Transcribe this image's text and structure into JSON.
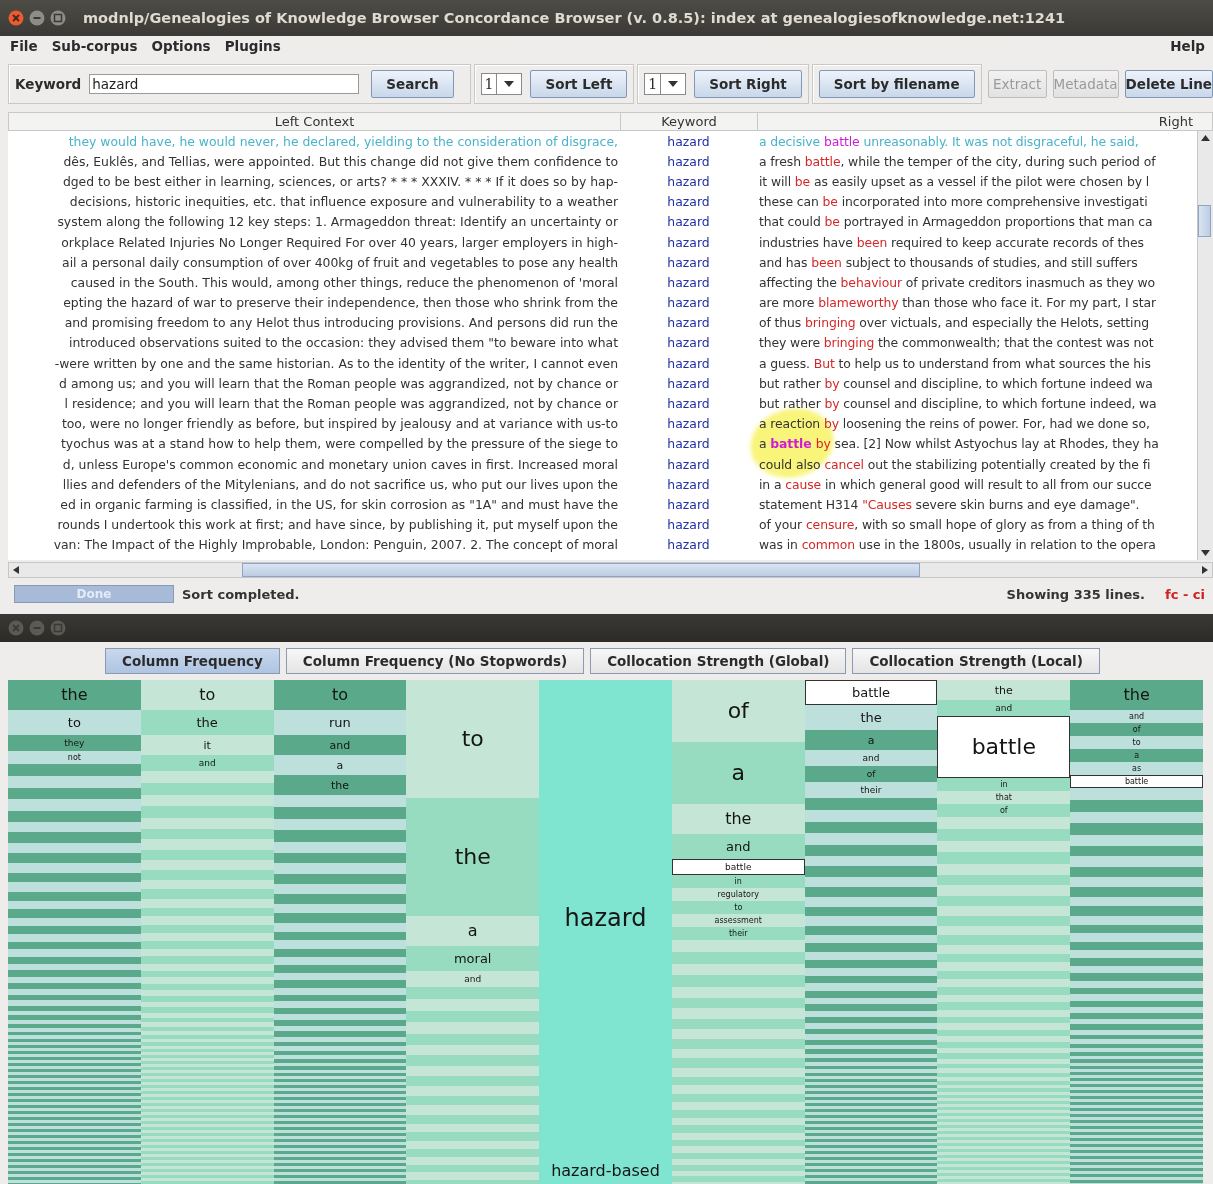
{
  "window": {
    "title": "modnlp/Genealogies of Knowledge Browser Concordance Browser (v. 0.8.5): index at genealogiesofknowledge.net:1241"
  },
  "menus": [
    "File",
    "Sub-corpus",
    "Options",
    "Plugins"
  ],
  "help_menu": "Help",
  "toolbar": {
    "keyword_label": "Keyword",
    "keyword": "hazard",
    "search_button": "Search",
    "sort_left": {
      "depth": "1",
      "button": "Sort Left"
    },
    "sort_right": {
      "depth": "1",
      "button": "Sort Right"
    },
    "buttons": [
      {
        "label": "Sort by filename",
        "disabled": false,
        "grouped": true
      },
      {
        "label": "Extract",
        "disabled": true,
        "grouped": false
      },
      {
        "label": "Metadata",
        "disabled": true,
        "grouped": false
      },
      {
        "label": "Delete Line",
        "disabled": false,
        "grouped": false
      }
    ]
  },
  "concordance": {
    "columns": [
      "Left Context",
      "Keyword",
      "Right"
    ],
    "marker_highlight": true,
    "rows": [
      {
        "selected": true,
        "left": "they would have, he would never, he declared, yielding to the consideration of disgrace,",
        "keyword": "hazard",
        "right": [
          {
            "text": "a decisive ",
            "kind": "plain"
          },
          {
            "text": "battle",
            "kind": "hit"
          },
          {
            "text": " unreasonably. It was not disgraceful, he said,",
            "kind": "plain"
          }
        ]
      },
      {
        "selected": false,
        "left": "dês, Euklês, and Tellias, were appointed. But this change did not give them confidence to",
        "keyword": "hazard",
        "right": [
          {
            "text": "a fresh ",
            "kind": "plain"
          },
          {
            "text": "battle",
            "kind": "sort"
          },
          {
            "text": ", while the temper of the city, during such period of",
            "kind": "plain"
          }
        ]
      },
      {
        "selected": false,
        "left": "dged to be best either in learning, sciences, or arts? * * * XXXIV. * * * If it does so by hap-",
        "keyword": "hazard",
        "right": [
          {
            "text": "it will ",
            "kind": "plain"
          },
          {
            "text": "be",
            "kind": "sort"
          },
          {
            "text": " as easily upset as a vessel if the pilot were chosen by l",
            "kind": "plain"
          }
        ]
      },
      {
        "selected": false,
        "left": "decisions, historic inequities, etc. that influence exposure and vulnerability to a weather",
        "keyword": "hazard",
        "right": [
          {
            "text": "these can ",
            "kind": "plain"
          },
          {
            "text": "be",
            "kind": "sort"
          },
          {
            "text": " incorporated into more comprehensive investigati",
            "kind": "plain"
          }
        ]
      },
      {
        "selected": false,
        "left": "system along the following 12 key steps: 1. Armageddon threat: Identify an uncertainty or",
        "keyword": "hazard",
        "right": [
          {
            "text": "that could ",
            "kind": "plain"
          },
          {
            "text": "be",
            "kind": "sort"
          },
          {
            "text": " portrayed in Armageddon proportions that man ca",
            "kind": "plain"
          }
        ]
      },
      {
        "selected": false,
        "left": "orkplace Related Injuries No Longer Required For over 40 years, larger employers in high-",
        "keyword": "hazard",
        "right": [
          {
            "text": "industries have ",
            "kind": "plain"
          },
          {
            "text": "been",
            "kind": "sort"
          },
          {
            "text": " required to keep accurate records of thes",
            "kind": "plain"
          }
        ]
      },
      {
        "selected": false,
        "left": "ail a personal daily consumption of over 400kg of fruit and vegetables to pose any health",
        "keyword": "hazard",
        "right": [
          {
            "text": "and has ",
            "kind": "plain"
          },
          {
            "text": "been",
            "kind": "sort"
          },
          {
            "text": " subject to thousands of studies, and still suffers",
            "kind": "plain"
          }
        ]
      },
      {
        "selected": false,
        "left": "caused in the South. This would, among other things, reduce the phenomenon of 'moral",
        "keyword": "hazard",
        "right": [
          {
            "text": "affecting the ",
            "kind": "plain"
          },
          {
            "text": "behaviour",
            "kind": "sort"
          },
          {
            "text": " of private creditors inasmuch as they wo",
            "kind": "plain"
          }
        ]
      },
      {
        "selected": false,
        "left": "epting the hazard of war to preserve their independence, then those who shrink from the",
        "keyword": "hazard",
        "right": [
          {
            "text": "are more ",
            "kind": "plain"
          },
          {
            "text": "blameworthy",
            "kind": "sort"
          },
          {
            "text": " than those who face it. For my part, I star",
            "kind": "plain"
          }
        ]
      },
      {
        "selected": false,
        "left": "and promising freedom to any Helot thus introducing provisions. And persons did run the",
        "keyword": "hazard",
        "right": [
          {
            "text": "of thus ",
            "kind": "plain"
          },
          {
            "text": "bringing",
            "kind": "sort"
          },
          {
            "text": " over victuals, and especially the Helots, setting",
            "kind": "plain"
          }
        ]
      },
      {
        "selected": false,
        "left": "introduced observations suited to the occasion: they advised them \"to beware into what",
        "keyword": "hazard",
        "right": [
          {
            "text": "they were ",
            "kind": "plain"
          },
          {
            "text": "bringing",
            "kind": "sort"
          },
          {
            "text": " the commonwealth; that the contest was not",
            "kind": "plain"
          }
        ]
      },
      {
        "selected": false,
        "left": "-were written by one and the same historian. As to the identity of the writer, I cannot even",
        "keyword": "hazard",
        "right": [
          {
            "text": "a guess. ",
            "kind": "plain"
          },
          {
            "text": "But",
            "kind": "sort"
          },
          {
            "text": " to help us to understand from what sources the his",
            "kind": "plain"
          }
        ]
      },
      {
        "selected": false,
        "left": "d among us; and you will learn that the Roman people was aggrandized, not by chance or",
        "keyword": "hazard",
        "right": [
          {
            "text": "but rather ",
            "kind": "plain"
          },
          {
            "text": "by",
            "kind": "sort"
          },
          {
            "text": " counsel and discipline, to which fortune indeed wa",
            "kind": "plain"
          }
        ]
      },
      {
        "selected": false,
        "left": "l residence; and you will learn that the Roman people was aggrandized, not by chance or",
        "keyword": "hazard",
        "right": [
          {
            "text": "but rather ",
            "kind": "plain"
          },
          {
            "text": "by",
            "kind": "sort"
          },
          {
            "text": " counsel and discipline, to which fortune indeed, wa",
            "kind": "plain"
          }
        ]
      },
      {
        "selected": false,
        "left": "too, were no longer friendly as before, but inspired by jealousy and at variance with us-to",
        "keyword": "hazard",
        "right": [
          {
            "text": "a reaction ",
            "kind": "plain"
          },
          {
            "text": "by",
            "kind": "sort"
          },
          {
            "text": " loosening the reins of power. For, had we done so,",
            "kind": "plain"
          }
        ]
      },
      {
        "selected": false,
        "left": "tyochus was at a stand how to help them, were compelled by the pressure of the siege to",
        "keyword": "hazard",
        "right": [
          {
            "text": "a ",
            "kind": "plain"
          },
          {
            "text": "battle ",
            "kind": "hit"
          },
          {
            "text": "by",
            "kind": "sort"
          },
          {
            "text": " sea. [2] Now whilst Astyochus lay at Rhodes, they ha",
            "kind": "plain"
          }
        ]
      },
      {
        "selected": false,
        "left": "d, unless Europe's common economic and monetary union caves in first. Increased moral",
        "keyword": "hazard",
        "right": [
          {
            "text": "could also ",
            "kind": "plain"
          },
          {
            "text": "cancel",
            "kind": "sort"
          },
          {
            "text": " out the stabilizing potentially created by the fi",
            "kind": "plain"
          }
        ]
      },
      {
        "selected": false,
        "left": "llies and defenders of the Mitylenians, and do not sacrifice us, who put our lives upon the",
        "keyword": "hazard",
        "right": [
          {
            "text": "in a ",
            "kind": "plain"
          },
          {
            "text": "cause",
            "kind": "sort"
          },
          {
            "text": " in which general good will result to all from our succe",
            "kind": "plain"
          }
        ]
      },
      {
        "selected": false,
        "left": "ed in organic farming is classified, in the US, for skin corrosion as \"1A\" and must have the",
        "keyword": "hazard",
        "right": [
          {
            "text": "statement H314 ",
            "kind": "plain"
          },
          {
            "text": "\"Causes",
            "kind": "sort"
          },
          {
            "text": " severe skin burns and eye damage\".",
            "kind": "plain"
          }
        ]
      },
      {
        "selected": false,
        "left": "rounds I undertook this work at first; and have since, by publishing it, put myself upon the",
        "keyword": "hazard",
        "right": [
          {
            "text": "of your ",
            "kind": "plain"
          },
          {
            "text": "censure",
            "kind": "sort"
          },
          {
            "text": ", with so small hope of glory as from a thing of th",
            "kind": "plain"
          }
        ]
      },
      {
        "selected": false,
        "left": "van: The Impact of the Highly Improbable, London: Penguin, 2007. 2. The concept of moral",
        "keyword": "hazard",
        "right": [
          {
            "text": "was in ",
            "kind": "plain"
          },
          {
            "text": "common",
            "kind": "sort"
          },
          {
            "text": " use in the 1800s, usually in relation to the opera",
            "kind": "plain"
          }
        ]
      }
    ]
  },
  "status_bar": {
    "progress": {
      "label": "Done",
      "level": 1
    },
    "message": "Sort completed.",
    "lines": "Showing 335 lines.",
    "flags": "fc - ci"
  },
  "viz_window": {
    "tabs": [
      {
        "label": "Column Frequency",
        "selected": true
      },
      {
        "label": "Column Frequency (No Stopwords)",
        "selected": false
      },
      {
        "label": "Collocation Strength (Global)",
        "selected": false
      },
      {
        "label": "Collocation Strength (Local)",
        "selected": false
      }
    ],
    "columns": [
      {
        "kind": "context",
        "blocks": [
          {
            "word": "the",
            "kind": "large",
            "highlighted": false
          },
          {
            "word": "to",
            "kind": "medium",
            "highlighted": false
          },
          {
            "word": "they",
            "kind": "tiny",
            "highlighted": false
          },
          {
            "word": "not",
            "kind": "minute",
            "highlighted": false
          }
        ]
      },
      {
        "kind": "context",
        "blocks": [
          {
            "word": "to",
            "kind": "large",
            "highlighted": false
          },
          {
            "word": "the",
            "kind": "medium",
            "highlighted": false
          },
          {
            "word": "it",
            "kind": "small",
            "highlighted": false
          },
          {
            "word": "and",
            "kind": "tiny",
            "highlighted": false
          }
        ]
      },
      {
        "kind": "context",
        "blocks": [
          {
            "word": "to",
            "kind": "large",
            "highlighted": false
          },
          {
            "word": "run",
            "kind": "medium",
            "highlighted": false
          },
          {
            "word": "and",
            "kind": "small",
            "highlighted": false
          },
          {
            "word": "a",
            "kind": "small",
            "highlighted": false
          },
          {
            "word": "the",
            "kind": "small",
            "highlighted": false
          }
        ]
      },
      {
        "kind": "context",
        "blocks": [
          {
            "word": "to",
            "kind": "huge",
            "highlighted": false
          },
          {
            "word": "the",
            "kind": "huge",
            "highlighted": false
          },
          {
            "word": "a",
            "kind": "large",
            "highlighted": false
          },
          {
            "word": "moral",
            "kind": "medium",
            "highlighted": false
          },
          {
            "word": "and",
            "kind": "tiny",
            "highlighted": false
          }
        ]
      },
      {
        "kind": "keyword",
        "blocks": [
          {
            "word": "hazard",
            "kind": "fill",
            "highlighted": false
          },
          {
            "word": "hazard-based",
            "kind": "large",
            "highlighted": false
          }
        ]
      },
      {
        "kind": "context",
        "blocks": [
          {
            "word": "of",
            "kind": "big",
            "highlighted": false
          },
          {
            "word": "a",
            "kind": "big",
            "highlighted": false
          },
          {
            "word": "the",
            "kind": "large",
            "highlighted": false
          },
          {
            "word": "and",
            "kind": "medium",
            "highlighted": false
          },
          {
            "word": "battle",
            "kind": "tiny",
            "highlighted": true
          },
          {
            "word": "in",
            "kind": "minute",
            "highlighted": false
          },
          {
            "word": "regulatory",
            "kind": "minute",
            "highlighted": false
          },
          {
            "word": "to",
            "kind": "minute",
            "highlighted": false
          },
          {
            "word": "assessment",
            "kind": "minute",
            "highlighted": false
          },
          {
            "word": "their",
            "kind": "minute",
            "highlighted": false
          }
        ]
      },
      {
        "kind": "context",
        "blocks": [
          {
            "word": "battle",
            "kind": "medium",
            "highlighted": true
          },
          {
            "word": "the",
            "kind": "medium",
            "highlighted": false
          },
          {
            "word": "a",
            "kind": "small",
            "highlighted": false
          },
          {
            "word": "and",
            "kind": "tiny",
            "highlighted": false
          },
          {
            "word": "of",
            "kind": "tiny",
            "highlighted": false
          },
          {
            "word": "their",
            "kind": "tiny",
            "highlighted": false
          }
        ]
      },
      {
        "kind": "context",
        "blocks": [
          {
            "word": "the",
            "kind": "small",
            "highlighted": false
          },
          {
            "word": "and",
            "kind": "tiny",
            "highlighted": false
          },
          {
            "word": "battle",
            "kind": "big",
            "highlighted": true
          },
          {
            "word": "in",
            "kind": "minute",
            "highlighted": false
          },
          {
            "word": "that",
            "kind": "minute",
            "highlighted": false
          },
          {
            "word": "of",
            "kind": "minute",
            "highlighted": false
          }
        ]
      },
      {
        "kind": "context",
        "blocks": [
          {
            "word": "the",
            "kind": "large",
            "highlighted": false
          },
          {
            "word": "and",
            "kind": "minute",
            "highlighted": false
          },
          {
            "word": "of",
            "kind": "minute",
            "highlighted": false
          },
          {
            "word": "to",
            "kind": "minute",
            "highlighted": false
          },
          {
            "word": "a",
            "kind": "minute",
            "highlighted": false
          },
          {
            "word": "as",
            "kind": "minute",
            "highlighted": false
          },
          {
            "word": "battle",
            "kind": "minute",
            "highlighted": true
          }
        ]
      }
    ]
  }
}
